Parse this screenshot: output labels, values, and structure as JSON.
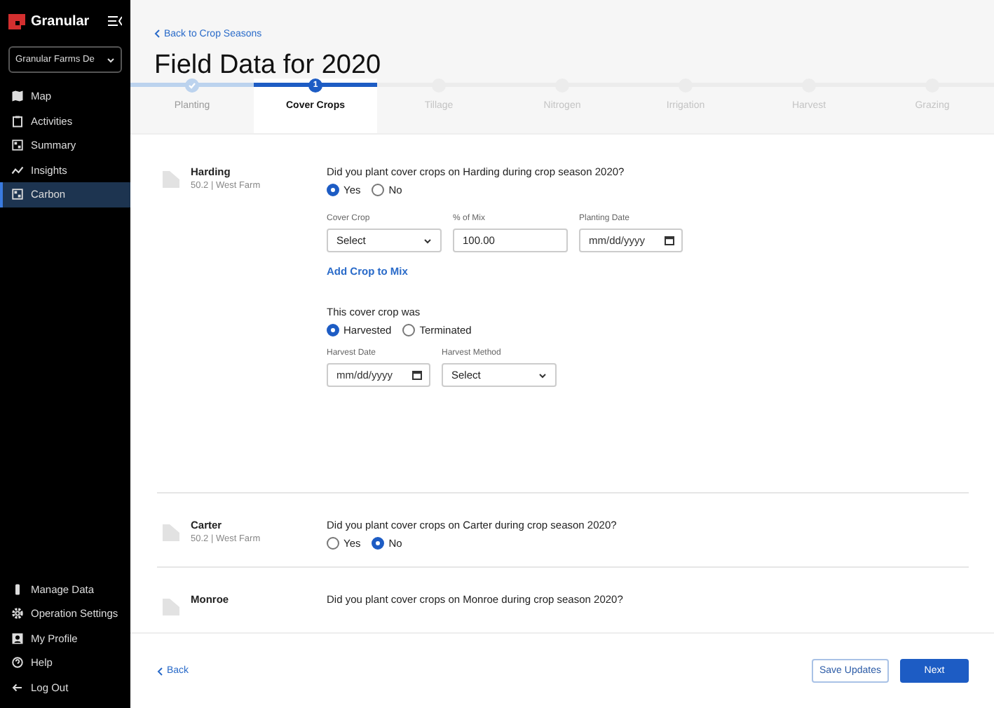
{
  "sidebar": {
    "brand": "Granular",
    "farm_select": "Granular Farms De",
    "nav": [
      {
        "label": "Map",
        "selected": false
      },
      {
        "label": "Activities",
        "selected": false
      },
      {
        "label": "Summary",
        "selected": false
      },
      {
        "label": "Insights",
        "selected": false
      },
      {
        "label": "Carbon",
        "selected": true
      }
    ],
    "bottom": [
      {
        "label": "Manage Data"
      },
      {
        "label": "Operation Settings"
      },
      {
        "label": "My Profile"
      },
      {
        "label": "Help"
      },
      {
        "label": "Log Out"
      }
    ]
  },
  "header": {
    "back_link": "Back to Crop Seasons",
    "title": "Field Data for 2020"
  },
  "steps": [
    {
      "label": "Planting",
      "completed": true,
      "selected": false
    },
    {
      "label": "Cover Crops",
      "completed": false,
      "selected": true,
      "number": "1"
    },
    {
      "label": "Tillage",
      "completed": false,
      "selected": false
    },
    {
      "label": "Nitrogen",
      "completed": false,
      "selected": false
    },
    {
      "label": "Irrigation",
      "completed": false,
      "selected": false
    },
    {
      "label": "Harvest",
      "completed": false,
      "selected": false
    },
    {
      "label": "Grazing",
      "completed": false,
      "selected": false
    }
  ],
  "fields": [
    {
      "name": "Harding",
      "meta": "50.2 | West Farm",
      "question": "Did you plant cover crops on Harding during crop season 2020?",
      "options": [
        {
          "label": "Yes",
          "selected": true
        },
        {
          "label": "No",
          "selected": false
        }
      ],
      "details": {
        "crop_inputs": [
          {
            "label": "Cover Crop",
            "kind": "select",
            "value": "Select"
          },
          {
            "label": "% of Mix",
            "kind": "text",
            "value": "100.00"
          },
          {
            "label": "Planting Date",
            "kind": "date",
            "placeholder": "mm/dd/yyyy"
          }
        ],
        "add_link": "Add Crop to Mix",
        "outcome_label": "This cover crop was",
        "outcome_options": [
          {
            "label": "Harvested",
            "selected": true
          },
          {
            "label": "Terminated",
            "selected": false
          }
        ],
        "harvest_inputs": [
          {
            "label": "Harvest Date",
            "kind": "date",
            "placeholder": "mm/dd/yyyy"
          },
          {
            "label": "Harvest Method",
            "kind": "select",
            "value": "Select"
          }
        ]
      }
    },
    {
      "name": "Carter",
      "meta": "50.2 | West Farm",
      "question": "Did you plant cover crops on Carter during crop season 2020?",
      "options": [
        {
          "label": "Yes",
          "selected": false
        },
        {
          "label": "No",
          "selected": true
        }
      ]
    },
    {
      "name": "Monroe",
      "question": "Did you plant cover crops on Monroe during crop season 2020?"
    }
  ],
  "footer": {
    "back": "Back",
    "save": "Save Updates",
    "next": "Next"
  }
}
